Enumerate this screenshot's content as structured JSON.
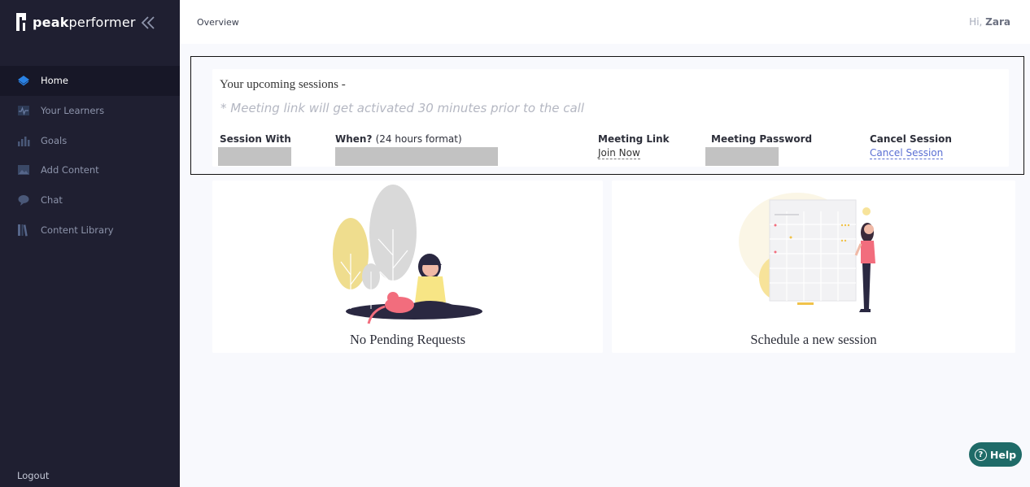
{
  "brand": {
    "name_bold": "peak",
    "name_rest": "performer"
  },
  "sidebar": {
    "items": [
      {
        "label": "Home",
        "icon": "layers-icon",
        "active": true
      },
      {
        "label": "Your Learners",
        "icon": "pulse-chart-icon",
        "active": false
      },
      {
        "label": "Goals",
        "icon": "bar-chart-icon",
        "active": false
      },
      {
        "label": "Add Content",
        "icon": "image-icon",
        "active": false
      },
      {
        "label": "Chat",
        "icon": "chat-bubble-icon",
        "active": false
      },
      {
        "label": "Content Library",
        "icon": "library-icon",
        "active": false
      }
    ],
    "logout_label": "Logout"
  },
  "header": {
    "title": "Overview",
    "greeting_prefix": "Hi,",
    "user_name": "Zara"
  },
  "sessions": {
    "title": "Your upcoming sessions -",
    "note": "* Meeting link will get activated 30 minutes prior to the call",
    "columns": {
      "session_with": "Session With",
      "when": "When?",
      "when_sub": "(24 hours format)",
      "meeting_link": "Meeting Link",
      "meeting_password": "Meeting Password",
      "cancel_session": "Cancel Session"
    },
    "row": {
      "join_link": "Join Now",
      "cancel_link": "Cancel Session"
    }
  },
  "cards": {
    "pending": {
      "label": "No Pending Requests"
    },
    "schedule": {
      "label": "Schedule a new session"
    }
  },
  "help": {
    "label": "Help"
  },
  "colors": {
    "sidebar_bg": "#1f1f31",
    "accent_blue": "#2a82e4",
    "help_bg": "#1f6b68",
    "link_blue": "#5a6fd3"
  }
}
